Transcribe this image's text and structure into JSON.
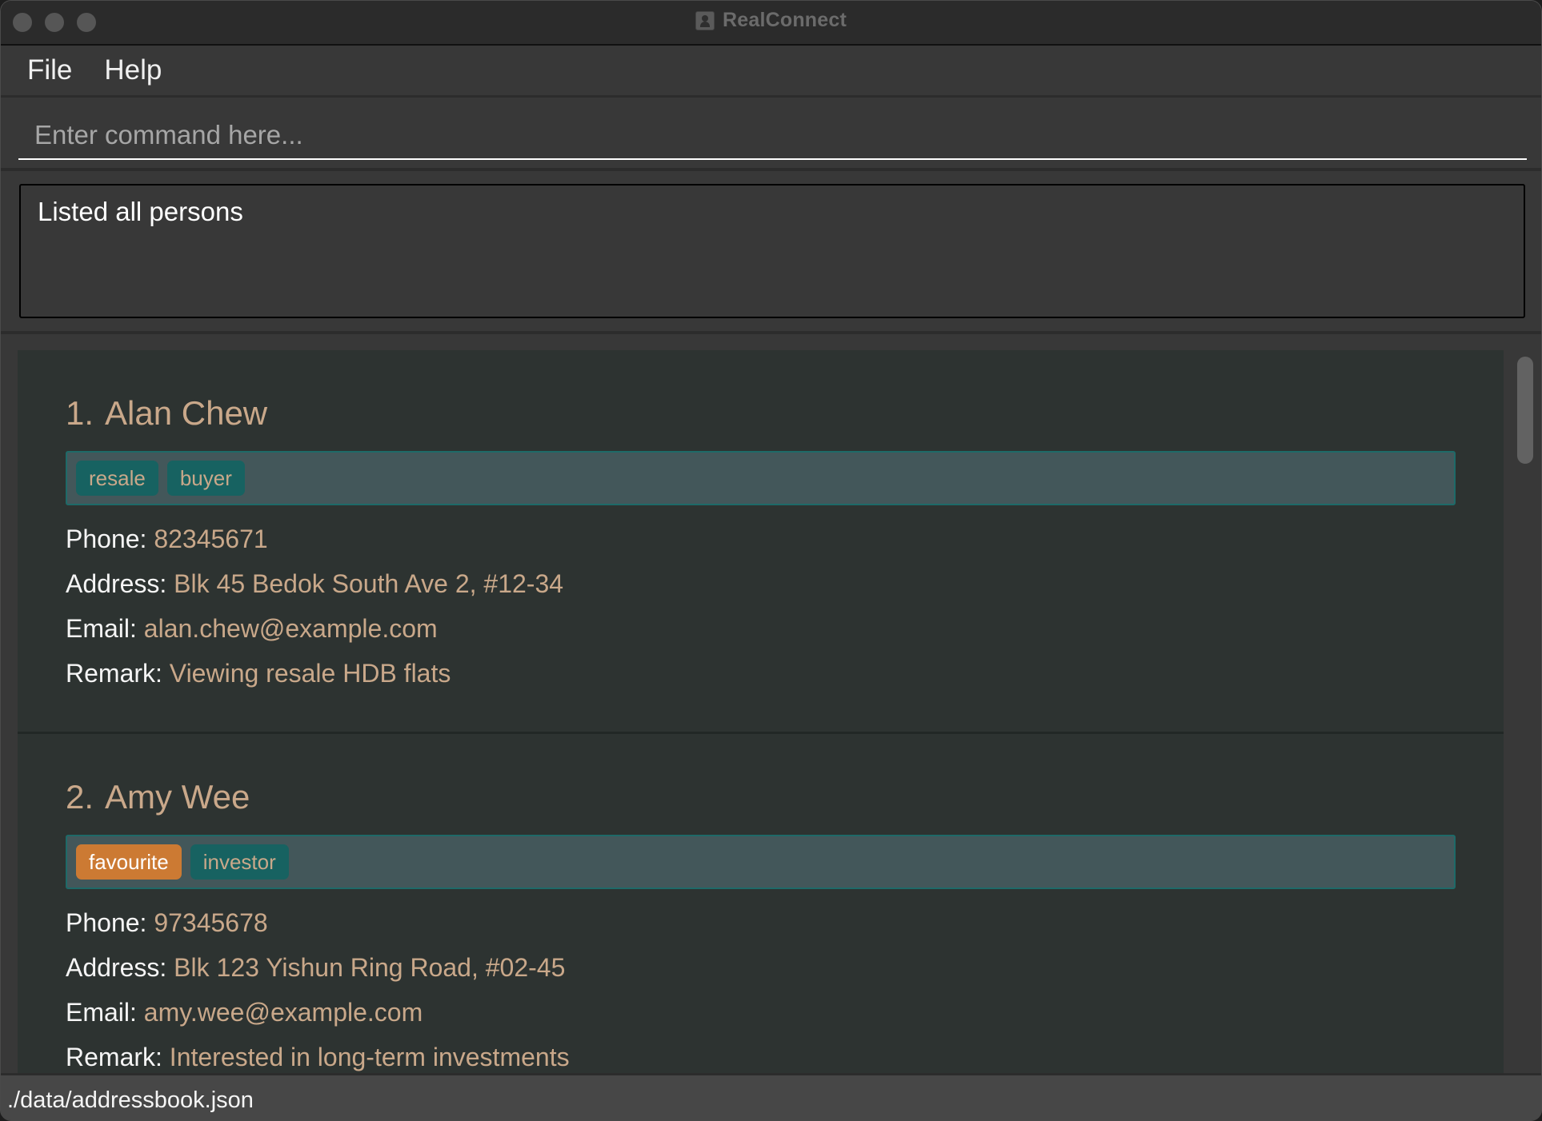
{
  "window": {
    "title": "RealConnect",
    "app_icon": "contact-book-icon"
  },
  "menu": {
    "items": [
      {
        "label": "File"
      },
      {
        "label": "Help"
      }
    ]
  },
  "command": {
    "placeholder": "Enter command here...",
    "value": ""
  },
  "result": {
    "message": "Listed all persons"
  },
  "persons": [
    {
      "index": "1.",
      "name": "Alan Chew",
      "tags": [
        {
          "label": "resale",
          "type": "normal"
        },
        {
          "label": "buyer",
          "type": "normal"
        }
      ],
      "phone_label": "Phone:",
      "phone": "82345671",
      "address_label": "Address:",
      "address": "Blk 45 Bedok South Ave 2, #12-34",
      "email_label": "Email:",
      "email": "alan.chew@example.com",
      "remark_label": "Remark:",
      "remark": "Viewing resale HDB flats"
    },
    {
      "index": "2.",
      "name": "Amy Wee",
      "tags": [
        {
          "label": "favourite",
          "type": "favourite"
        },
        {
          "label": "investor",
          "type": "normal"
        }
      ],
      "phone_label": "Phone:",
      "phone": "97345678",
      "address_label": "Address:",
      "address": "Blk 123 Yishun Ring Road, #02-45",
      "email_label": "Email:",
      "email": "amy.wee@example.com",
      "remark_label": "Remark:",
      "remark": "Interested in long-term investments"
    }
  ],
  "colors": {
    "accent_text": "#c9a88a",
    "tag_bg": "#176261",
    "favourite_tag_bg": "#cc7a33",
    "card_bg": "#2d3331"
  },
  "statusbar": {
    "path": "./data/addressbook.json"
  }
}
